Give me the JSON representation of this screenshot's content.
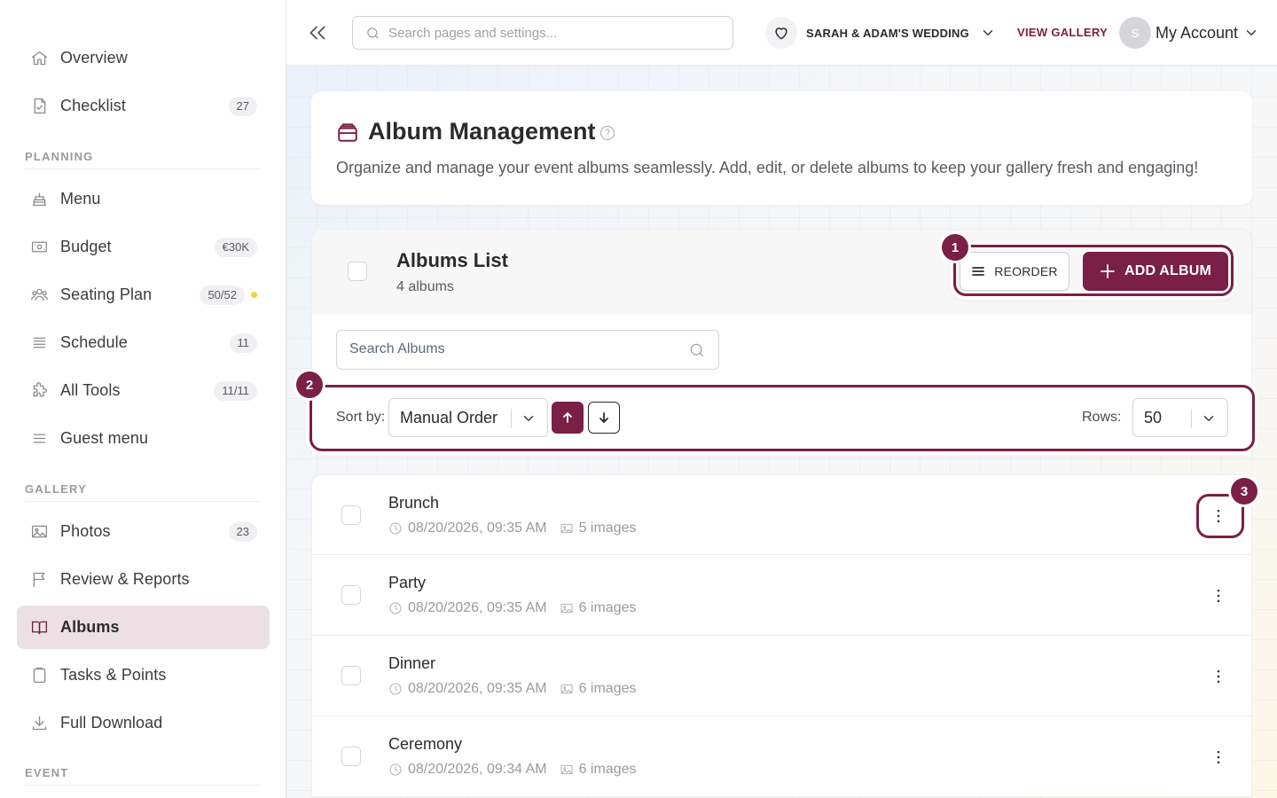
{
  "sidebar": {
    "items": [
      {
        "label": "Overview",
        "icon": "home-icon",
        "badge": ""
      },
      {
        "label": "Checklist",
        "icon": "document-check-icon",
        "badge": "27"
      },
      {
        "label": "Menu",
        "icon": "cake-icon",
        "badge": ""
      },
      {
        "label": "Budget",
        "icon": "banknote-icon",
        "badge": "€30K"
      },
      {
        "label": "Seating Plan",
        "icon": "users-icon",
        "badge": "50/52"
      },
      {
        "label": "Schedule",
        "icon": "list-icon",
        "badge": "11"
      },
      {
        "label": "All Tools",
        "icon": "puzzle-icon",
        "badge": "11/11"
      },
      {
        "label": "Guest menu",
        "icon": "menu-icon",
        "badge": ""
      },
      {
        "label": "Photos",
        "icon": "image-icon",
        "badge": "23"
      },
      {
        "label": "Review & Reports",
        "icon": "flag-icon",
        "badge": ""
      },
      {
        "label": "Albums",
        "icon": "book-open-icon",
        "badge": ""
      },
      {
        "label": "Tasks & Points",
        "icon": "clipboard-icon",
        "badge": ""
      },
      {
        "label": "Full Download",
        "icon": "download-icon",
        "badge": ""
      }
    ],
    "sections": {
      "planning": "PLANNING",
      "gallery": "GALLERY",
      "event": "EVENT"
    },
    "active": "Albums",
    "status_dot_color": "#f2d33b"
  },
  "topbar": {
    "search_placeholder": "Search pages and settings...",
    "event_name": "SARAH & ADAM'S WEDDING",
    "view_gallery": "VIEW GALLERY",
    "avatar_initial": "S",
    "account_label": "My Account"
  },
  "header": {
    "title": "Album Management",
    "description": "Organize and manage your event albums seamlessly. Add, edit, or delete albums to keep your gallery fresh and engaging!"
  },
  "albums_list": {
    "title": "Albums List",
    "count": "4 albums",
    "reorder_label": "REORDER",
    "add_label": "ADD ALBUM",
    "search_placeholder": "Search Albums",
    "sort_label": "Sort by:",
    "sort_value": "Manual Order",
    "rows_label": "Rows:",
    "rows_value": "50",
    "items": [
      {
        "name": "Brunch",
        "date": "08/20/2026, 09:35 AM",
        "images": "5 images"
      },
      {
        "name": "Party",
        "date": "08/20/2026, 09:35 AM",
        "images": "6 images"
      },
      {
        "name": "Dinner",
        "date": "08/20/2026, 09:35 AM",
        "images": "6 images"
      },
      {
        "name": "Ceremony",
        "date": "08/20/2026, 09:34 AM",
        "images": "6 images"
      }
    ]
  },
  "markers": [
    "1",
    "2",
    "3"
  ],
  "colors": {
    "accent": "#7a1f45",
    "active_bg": "#ede0e4"
  }
}
